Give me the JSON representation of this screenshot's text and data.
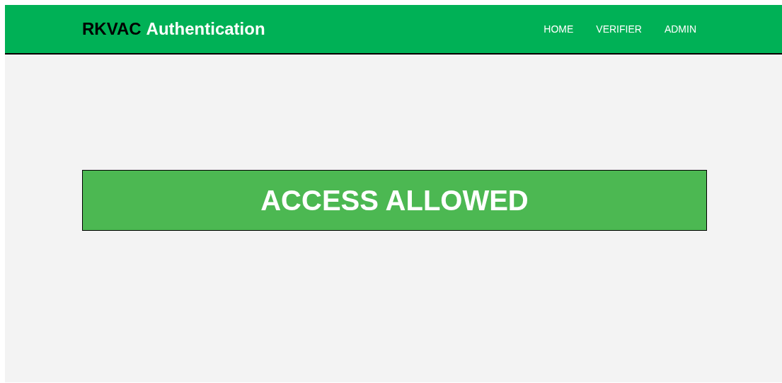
{
  "header": {
    "brand_dark": "RKVAC",
    "brand_light": "Authentication",
    "nav": [
      {
        "label": "HOME"
      },
      {
        "label": "VERIFIER"
      },
      {
        "label": "ADMIN"
      }
    ]
  },
  "result": {
    "message": "ACCESS ALLOWED"
  }
}
